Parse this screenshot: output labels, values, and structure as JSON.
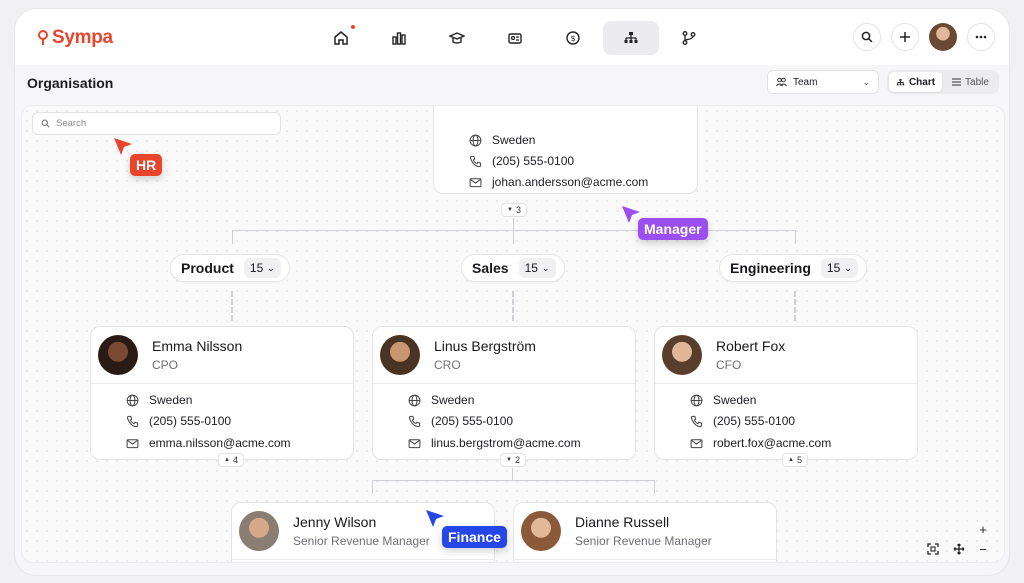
{
  "app": {
    "logo_text": "Sympa",
    "brand_color": "#e8452c"
  },
  "nav": {
    "icons": [
      "home-icon",
      "bar-chart-icon",
      "graduation-cap-icon",
      "id-card-icon",
      "dollar-icon",
      "org-chart-icon",
      "branch-icon"
    ],
    "active": "org-chart-icon"
  },
  "header": {
    "title": "Organisation",
    "team_select": "Team",
    "view_chart": "Chart",
    "view_table": "Table"
  },
  "search": {
    "placeholder": "Search"
  },
  "top_person": {
    "country": "Sweden",
    "phone": "(205) 555-0100",
    "email": "johan.andersson@acme.com",
    "reports": "3"
  },
  "departments": [
    {
      "name": "Product",
      "count": "15"
    },
    {
      "name": "Sales",
      "count": "15"
    },
    {
      "name": "Engineering",
      "count": "15"
    }
  ],
  "people": [
    {
      "name": "Emma Nilsson",
      "role": "CPO",
      "country": "Sweden",
      "phone": "(205) 555-0100",
      "email": "emma.nilsson@acme.com",
      "reports": "4"
    },
    {
      "name": "Linus Bergström",
      "role": "CRO",
      "country": "Sweden",
      "phone": "(205) 555-0100",
      "email": "linus.bergstrom@acme.com",
      "reports": "2"
    },
    {
      "name": "Robert Fox",
      "role": "CFO",
      "country": "Sweden",
      "phone": "(205) 555-0100",
      "email": "robert.fox@acme.com",
      "reports": "5"
    },
    {
      "name": "Jenny Wilson",
      "role": "Senior Revenue Manager"
    },
    {
      "name": "Dianne Russell",
      "role": "Senior Revenue Manager"
    }
  ],
  "cursors": [
    {
      "label": "HR",
      "color": "#e8452c"
    },
    {
      "label": "Manager",
      "color": "#9b4ff0"
    },
    {
      "label": "Finance",
      "color": "#2547e8"
    }
  ]
}
